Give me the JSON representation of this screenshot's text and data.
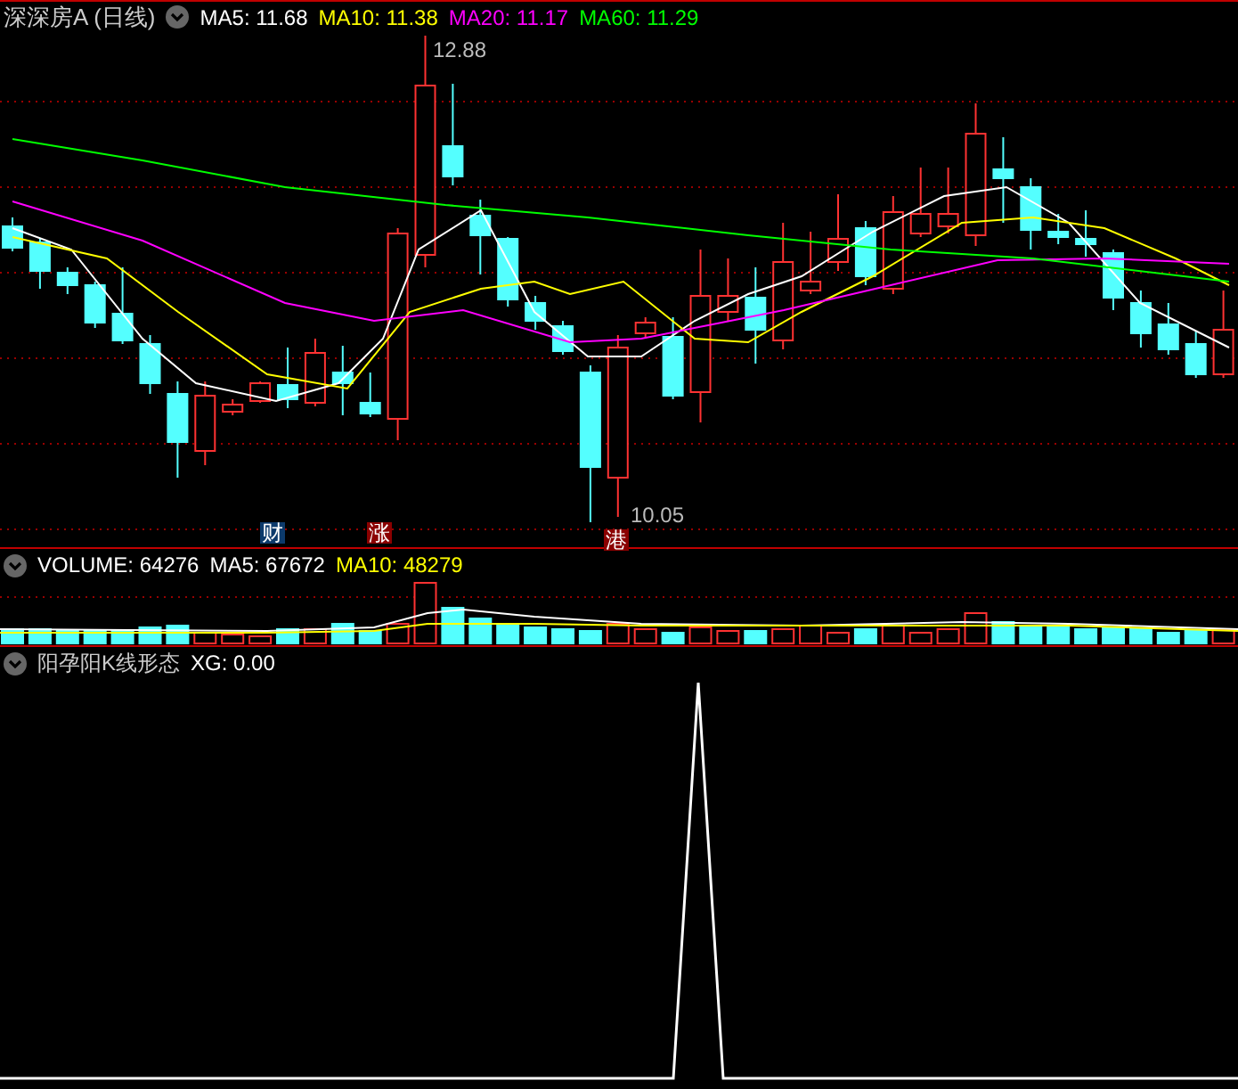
{
  "title": {
    "name": "深深房A",
    "period": "(日线)"
  },
  "price_legend": [
    {
      "label": "MA5: 11.68",
      "color": "#ffffff"
    },
    {
      "label": "MA10: 11.38",
      "color": "#ffff00"
    },
    {
      "label": "MA20: 11.17",
      "color": "#ff00ff"
    },
    {
      "label": "MA60: 11.29",
      "color": "#00ff00"
    }
  ],
  "price_chart": {
    "high_label": "12.88",
    "low_label": "10.05",
    "markers": [
      {
        "text": "财",
        "kind": "finance"
      },
      {
        "text": "涨",
        "kind": "rise"
      },
      {
        "text": "港",
        "kind": "rise"
      }
    ]
  },
  "volume_panel": {
    "legend": [
      {
        "label": "VOLUME: 64276",
        "color": "#ffffff"
      },
      {
        "label": "MA5: 67672",
        "color": "#ffffff"
      },
      {
        "label": "MA10: 48279",
        "color": "#ffff00"
      }
    ]
  },
  "indicator_panel": {
    "name": "阳孕阳K线形态",
    "legend": [
      {
        "label": "XG: 0.00",
        "color": "#ffffff"
      }
    ]
  }
}
